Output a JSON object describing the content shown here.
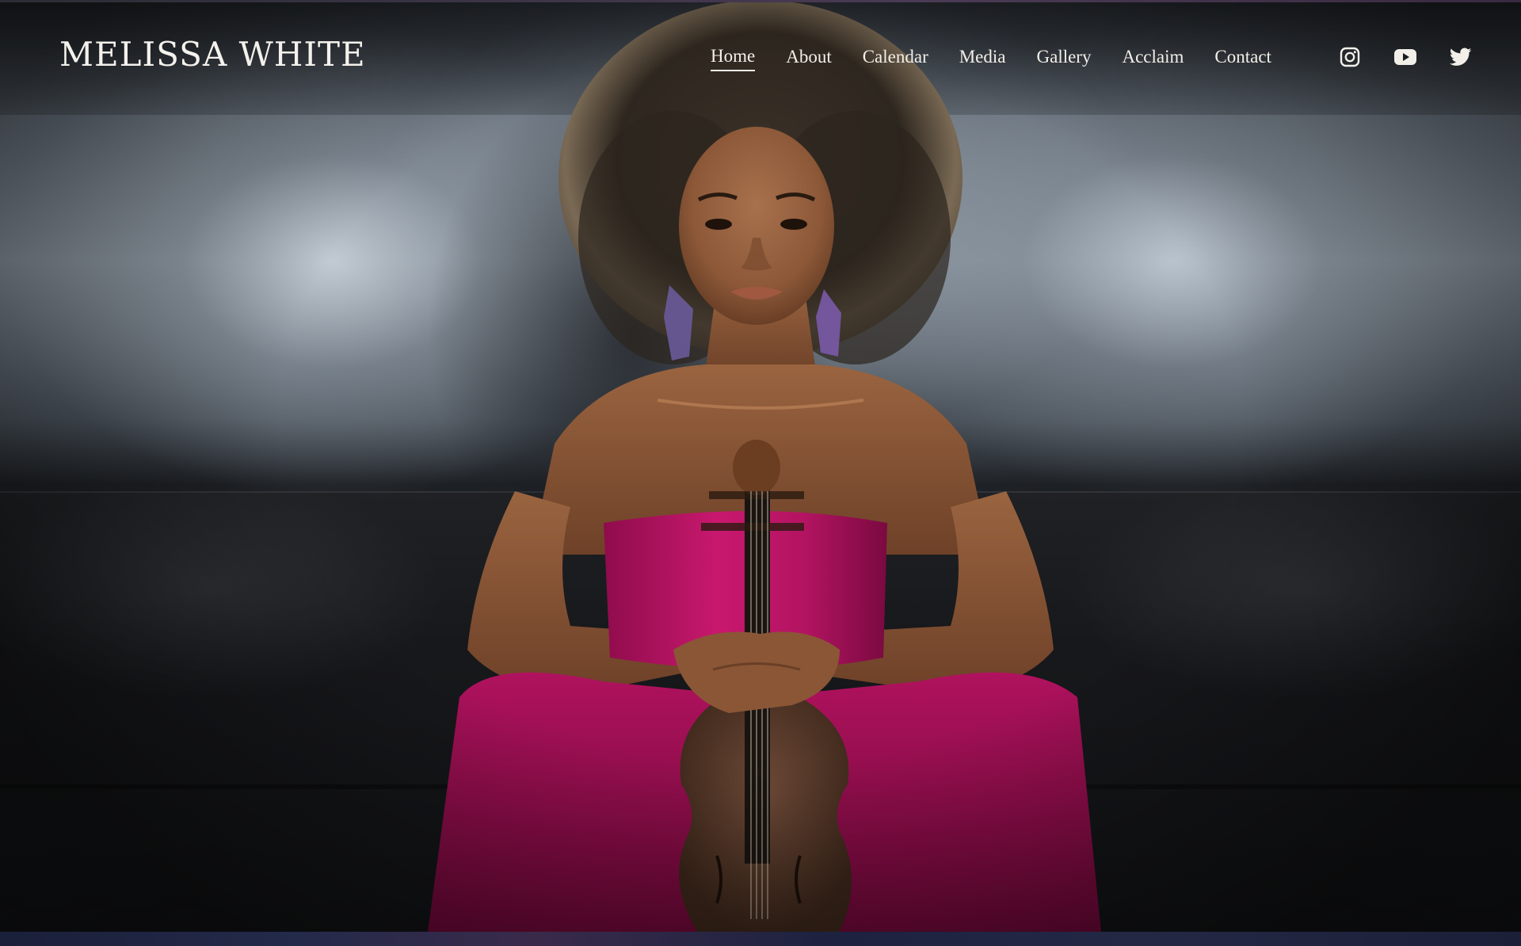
{
  "site": {
    "title": "MELISSA WHITE"
  },
  "nav": {
    "items": [
      {
        "label": "Home",
        "active": true
      },
      {
        "label": "About"
      },
      {
        "label": "Calendar"
      },
      {
        "label": "Media"
      },
      {
        "label": "Gallery"
      },
      {
        "label": "Acclaim"
      },
      {
        "label": "Contact"
      }
    ]
  },
  "social": {
    "icons": [
      "instagram-icon",
      "youtube-icon",
      "twitter-icon"
    ]
  },
  "hero": {
    "image_subject": "portrait-photo"
  },
  "colors": {
    "text": "#f2efe9",
    "dress": "#c01468",
    "skin": "#8a5a3c",
    "hair": "#2b241e"
  }
}
